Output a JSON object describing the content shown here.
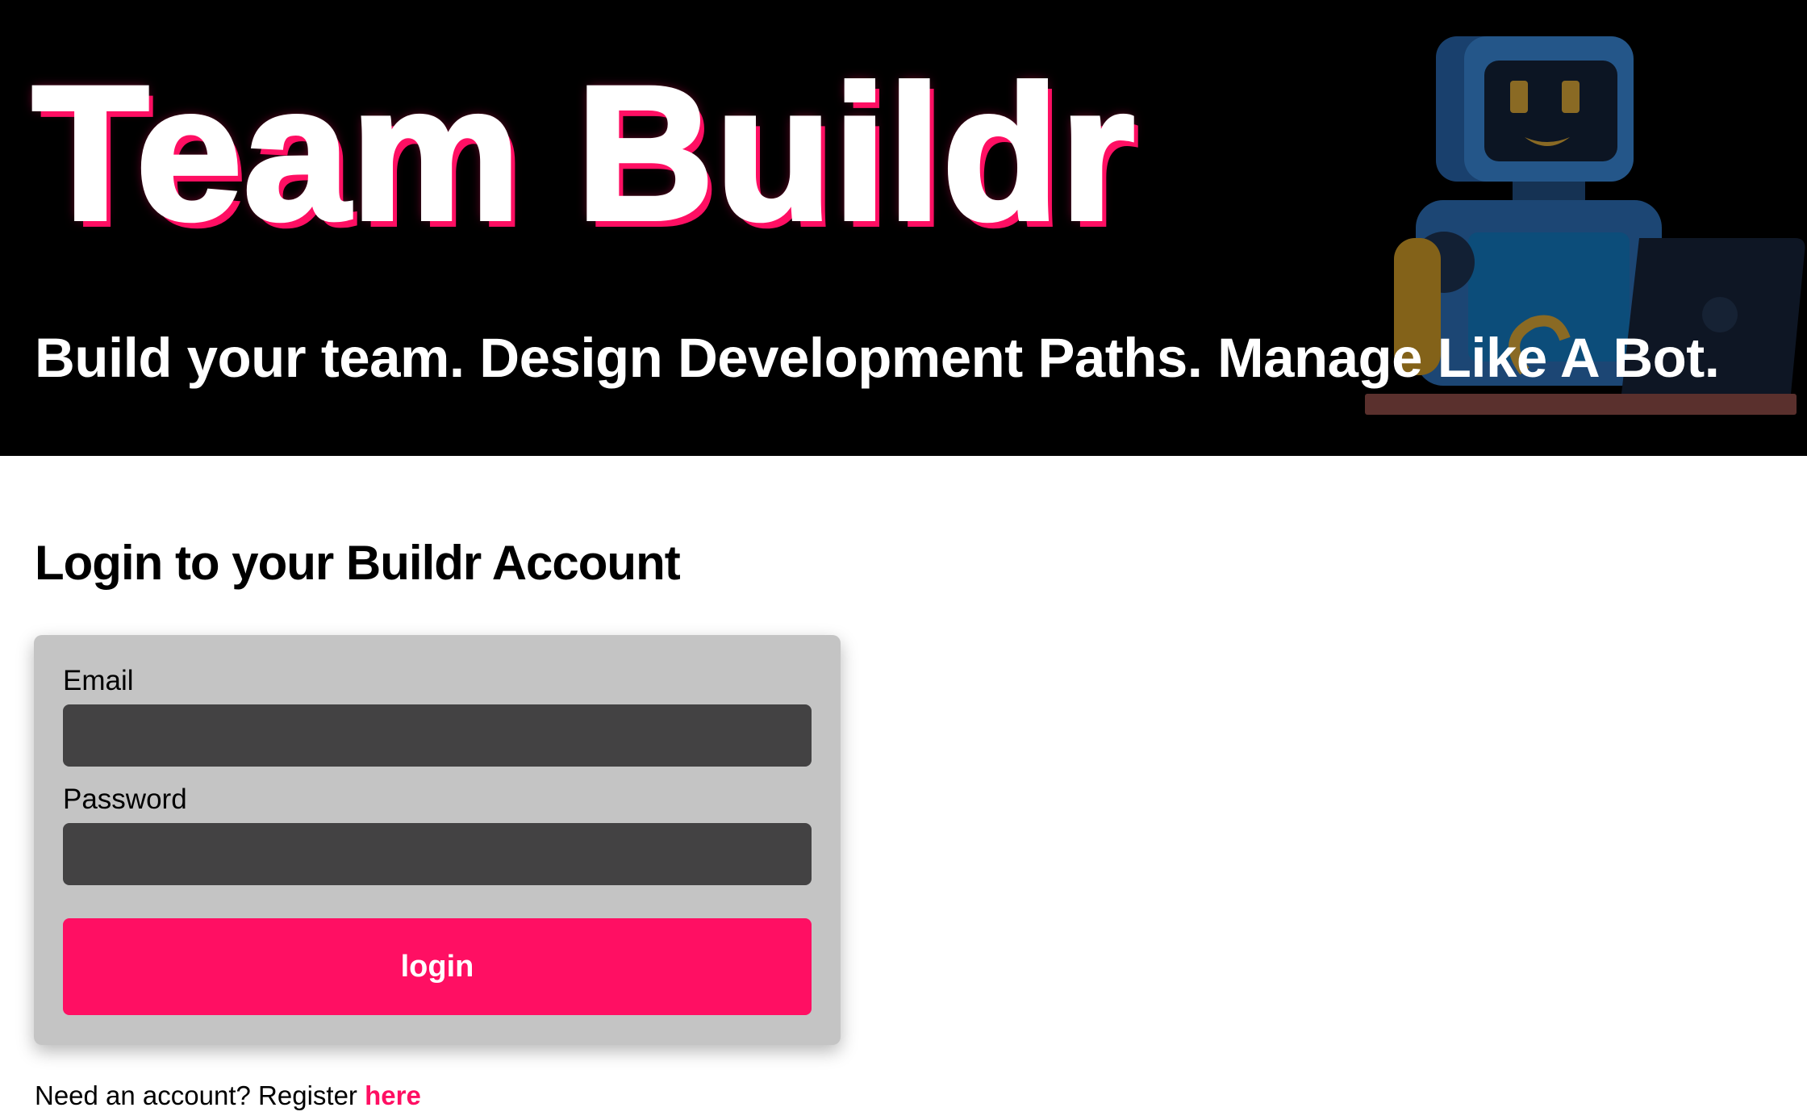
{
  "header": {
    "title": "Team Buildr",
    "subtitle": "Build your team. Design Development Paths. Manage Like A Bot.",
    "illustration_icon": "robot-at-laptop-icon"
  },
  "login": {
    "heading": "Login to your Buildr Account",
    "email_label": "Email",
    "email_value": "",
    "password_label": "Password",
    "password_value": "",
    "button_label": "login"
  },
  "register": {
    "prompt": "Need an account? Register",
    "link_label": "here"
  },
  "colors": {
    "accent": "#ff0f63",
    "header_background": "#000000",
    "card_background": "#c4c4c4",
    "input_background": "#434243"
  }
}
